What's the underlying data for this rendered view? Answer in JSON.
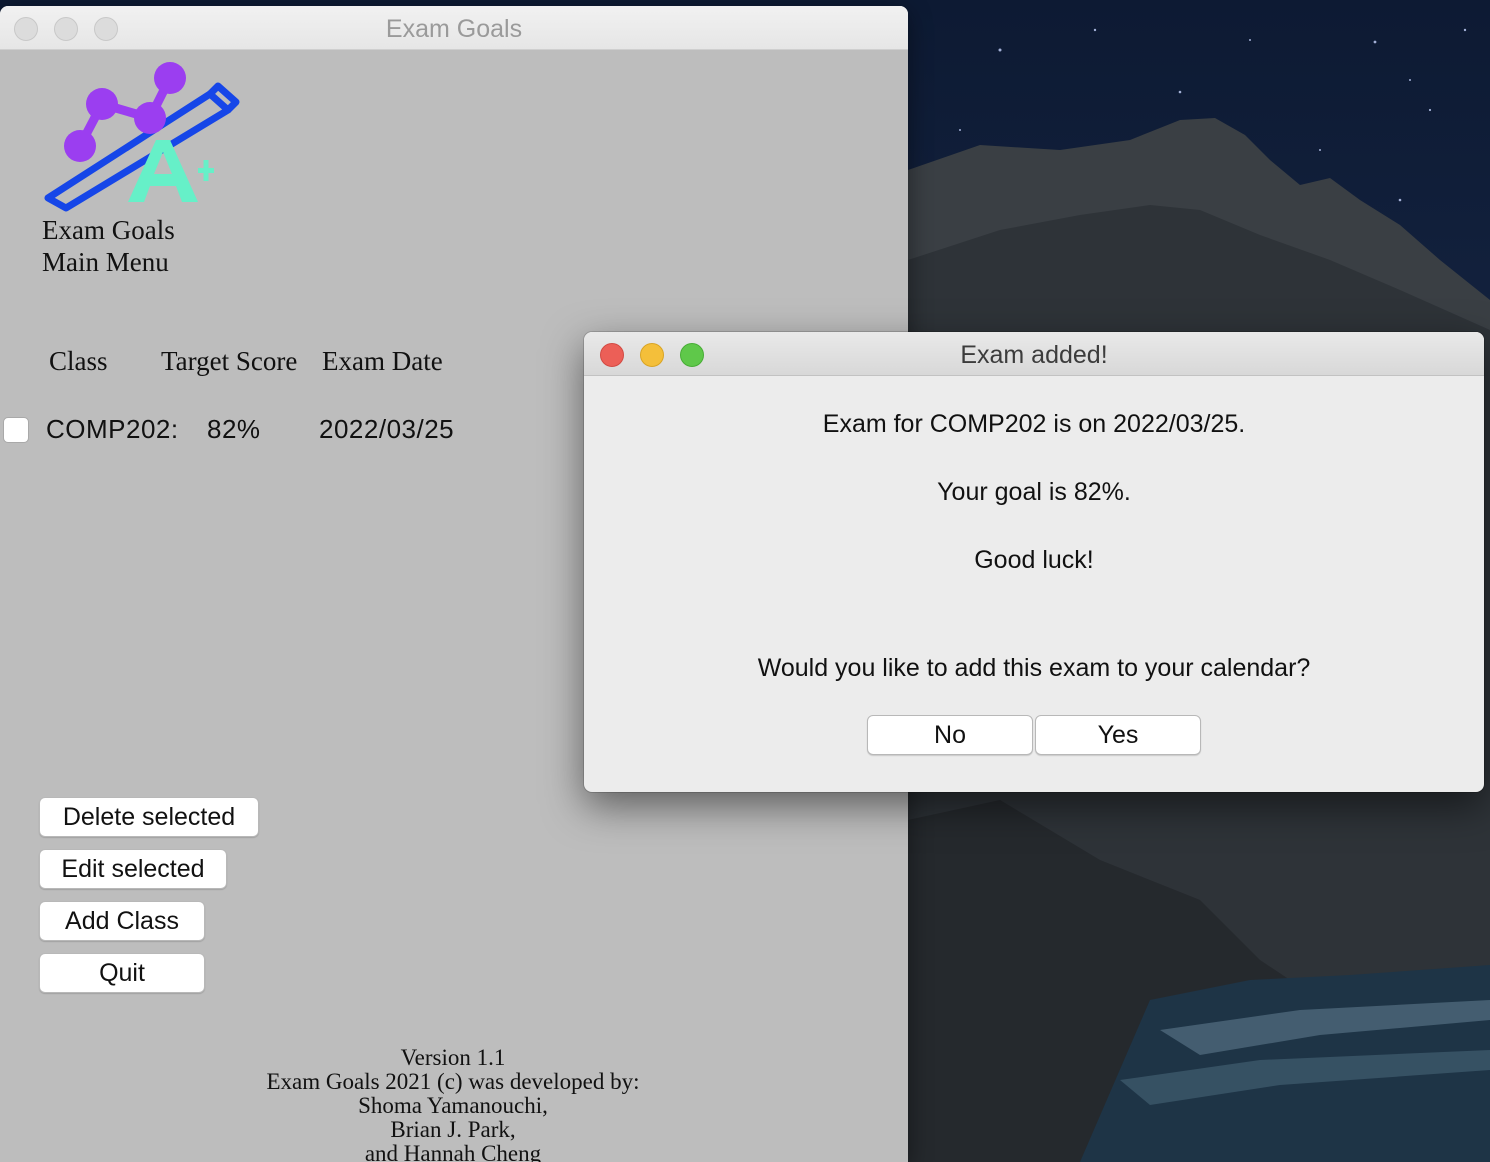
{
  "main_window": {
    "title": "Exam Goals",
    "app_name": "Exam Goals",
    "menu_name": "Main Menu",
    "columns": [
      "Class",
      "Target Score",
      "Exam Date"
    ],
    "rows": [
      {
        "class": "COMP202:",
        "target": "82%",
        "date": "2022/03/25",
        "checked": false
      }
    ],
    "buttons": {
      "delete": "Delete selected",
      "edit": "Edit selected",
      "add": "Add Class",
      "quit": "Quit"
    },
    "credits": [
      "Version 1.1",
      "Exam Goals 2021 (c) was developed by:",
      "Shoma Yamanouchi,",
      "Brian J. Park,",
      "and Hannah Cheng"
    ]
  },
  "dialog": {
    "title": "Exam added!",
    "line1": "Exam for COMP202 is on 2022/03/25.",
    "line2": "Your goal is 82%.",
    "line3": "Good luck!",
    "question": "Would you like to add this exam to your calendar?",
    "no_label": "No",
    "yes_label": "Yes"
  },
  "colors": {
    "logo_purple": "#9b3ef0",
    "logo_blue": "#1646e8",
    "logo_mint": "#66f0c8",
    "window_bg": "#bdbdbd",
    "dialog_bg": "#ececec"
  }
}
